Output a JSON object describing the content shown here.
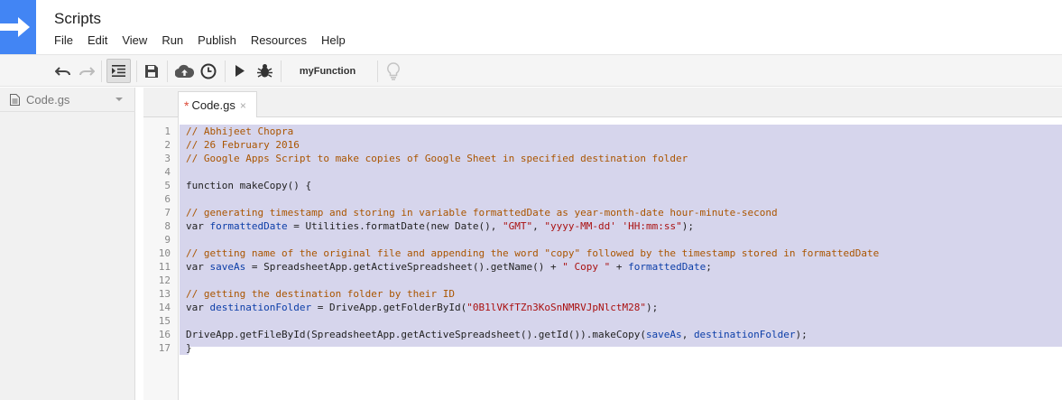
{
  "app": {
    "title": "Scripts"
  },
  "menu": [
    "File",
    "Edit",
    "View",
    "Run",
    "Publish",
    "Resources",
    "Help"
  ],
  "toolbar": {
    "function_name": "myFunction"
  },
  "sidebar": {
    "file_name": "Code.gs"
  },
  "tab": {
    "dirty_mark": "*",
    "label": "Code.gs",
    "close": "×"
  },
  "editor": {
    "line_numbers": [
      "1",
      "2",
      "3",
      "4",
      "5",
      "6",
      "7",
      "8",
      "9",
      "10",
      "11",
      "12",
      "13",
      "14",
      "15",
      "16",
      "17"
    ],
    "lines": [
      [
        {
          "t": "// Abhijeet Chopra",
          "c": "c"
        }
      ],
      [
        {
          "t": "// 26 February 2016",
          "c": "c"
        }
      ],
      [
        {
          "t": "// Google Apps Script to make copies of Google Sheet in specified destination folder",
          "c": "c"
        }
      ],
      [],
      [
        {
          "t": "function makeCopy() {",
          "c": "k"
        }
      ],
      [],
      [
        {
          "t": "// generating timestamp and storing in variable formattedDate as year-month-date hour-minute-second",
          "c": "c"
        }
      ],
      [
        {
          "t": "var ",
          "c": "k"
        },
        {
          "t": "formattedDate",
          "c": "v"
        },
        {
          "t": " = Utilities.formatDate(new Date(), ",
          "c": "p"
        },
        {
          "t": "\"GMT\"",
          "c": "s"
        },
        {
          "t": ", ",
          "c": "p"
        },
        {
          "t": "\"yyyy-MM-dd' 'HH:mm:ss\"",
          "c": "s"
        },
        {
          "t": ");",
          "c": "p"
        }
      ],
      [],
      [
        {
          "t": "// getting name of the original file and appending the word \"copy\" followed by the timestamp stored in formattedDate",
          "c": "c"
        }
      ],
      [
        {
          "t": "var ",
          "c": "k"
        },
        {
          "t": "saveAs",
          "c": "v"
        },
        {
          "t": " = SpreadsheetApp.getActiveSpreadsheet().getName() + ",
          "c": "p"
        },
        {
          "t": "\" Copy \"",
          "c": "s"
        },
        {
          "t": " + ",
          "c": "p"
        },
        {
          "t": "formattedDate",
          "c": "v"
        },
        {
          "t": ";",
          "c": "p"
        }
      ],
      [],
      [
        {
          "t": "// getting the destination folder by their ID",
          "c": "c"
        }
      ],
      [
        {
          "t": "var ",
          "c": "k"
        },
        {
          "t": "destinationFolder",
          "c": "v"
        },
        {
          "t": " = DriveApp.getFolderById(",
          "c": "p"
        },
        {
          "t": "\"0B1lVKfTZn3KoSnNMRVJpNlctM28\"",
          "c": "s"
        },
        {
          "t": ");",
          "c": "p"
        }
      ],
      [],
      [
        {
          "t": "DriveApp.getFileById(SpreadsheetApp.getActiveSpreadsheet().getId()).makeCopy(",
          "c": "p"
        },
        {
          "t": "saveAs",
          "c": "v"
        },
        {
          "t": ", ",
          "c": "p"
        },
        {
          "t": "destinationFolder",
          "c": "v"
        },
        {
          "t": ");",
          "c": "p"
        }
      ],
      [
        {
          "t": "}",
          "c": "p"
        }
      ]
    ]
  },
  "colors": {
    "brand": "#4285f4",
    "comment": "#aa5500",
    "string": "#aa1111",
    "variable": "#0c3ea8",
    "selection": "#d6d5ec",
    "dirty": "#dd4b39"
  },
  "icons": [
    "arrow-right-icon",
    "undo-icon",
    "redo-icon",
    "indent-icon",
    "save-icon",
    "cloud-upload-icon",
    "clock-icon",
    "play-icon",
    "bug-icon",
    "lightbulb-icon",
    "file-icon",
    "chevron-down-icon",
    "close-icon"
  ]
}
